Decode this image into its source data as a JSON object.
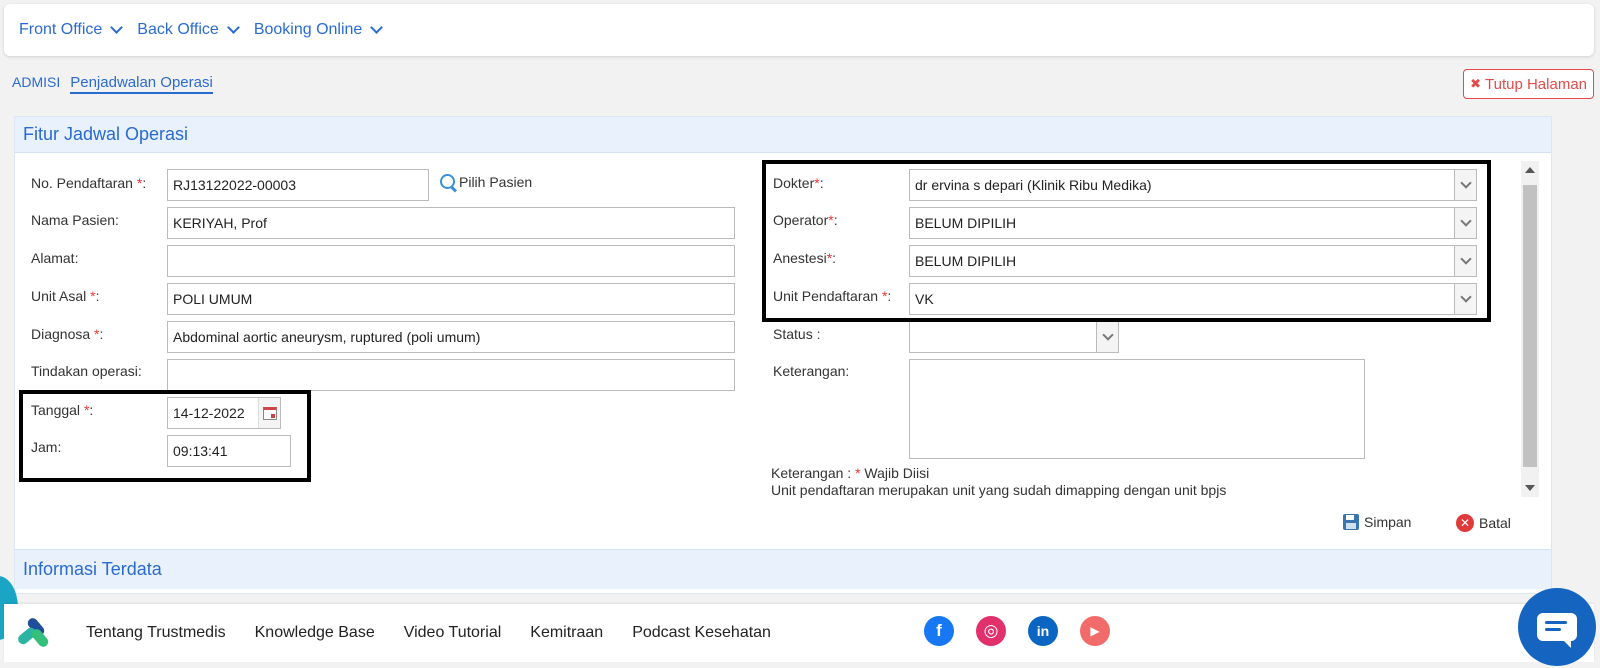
{
  "nav": {
    "items": [
      {
        "label": "Front Office"
      },
      {
        "label": "Back Office"
      },
      {
        "label": "Booking Online"
      }
    ]
  },
  "breadcrumb": {
    "root": "ADMISI",
    "active": "Penjadwalan Operasi"
  },
  "close_page": {
    "label": "Tutup Halaman",
    "color": "#e34b4b"
  },
  "form": {
    "title": "Fitur Jadwal Operasi",
    "no_pendaftaran": {
      "label": "No. Pendaftaran",
      "value": "RJ13122022-00003"
    },
    "pilih_pasien": "Pilih Pasien",
    "nama_pasien": {
      "label": "Nama Pasien:",
      "value": "KERIYAH, Prof"
    },
    "alamat": {
      "label": "Alamat:",
      "value": ""
    },
    "unit_asal": {
      "label": "Unit Asal",
      "value": "POLI UMUM"
    },
    "diagnosa": {
      "label": "Diagnosa",
      "value": "Abdominal aortic aneurysm, ruptured (poli umum)"
    },
    "tindakan_operasi": {
      "label": "Tindakan operasi:",
      "value": ""
    },
    "tanggal": {
      "label": "Tanggal",
      "value": "14-12-2022"
    },
    "jam": {
      "label": "Jam:",
      "value": "09:13:41"
    },
    "dokter": {
      "label": "Dokter",
      "value": "dr ervina s depari (Klinik Ribu Medika)"
    },
    "operator": {
      "label": "Operator",
      "value": "BELUM DIPILIH"
    },
    "anestesi": {
      "label": "Anestesi",
      "value": "BELUM DIPILIH"
    },
    "unit_pendaftaran": {
      "label": "Unit Pendaftaran",
      "value": "VK"
    },
    "status": {
      "label": "Status :",
      "value": ""
    },
    "keterangan": {
      "label": "Keterangan:",
      "value": ""
    },
    "note_prefix": "Keterangan :",
    "note_required": "Wajib Diisi",
    "note_line2": "Unit pendaftaran merupakan unit yang sudah dimapping dengan unit bpjs",
    "save_label": "Simpan",
    "cancel_label": "Batal"
  },
  "info": {
    "title": "Informasi Terdata"
  },
  "footer": {
    "links": [
      "Tentang Trustmedis",
      "Knowledge Base",
      "Video Tutorial",
      "Kemitraan",
      "Podcast Kesehatan"
    ],
    "socials": [
      {
        "icon": "facebook-icon",
        "glyph": "f",
        "color": "#1877f2"
      },
      {
        "icon": "instagram-icon",
        "glyph": "◎",
        "color": "#e1306c"
      },
      {
        "icon": "linkedin-icon",
        "glyph": "in",
        "color": "#0a66c2"
      },
      {
        "icon": "youtube-icon",
        "glyph": "▶",
        "color": "#f26b6b"
      }
    ]
  },
  "colors": {
    "accent": "#2a6bd1",
    "required": "#e33333",
    "chat": "#1565c0"
  }
}
